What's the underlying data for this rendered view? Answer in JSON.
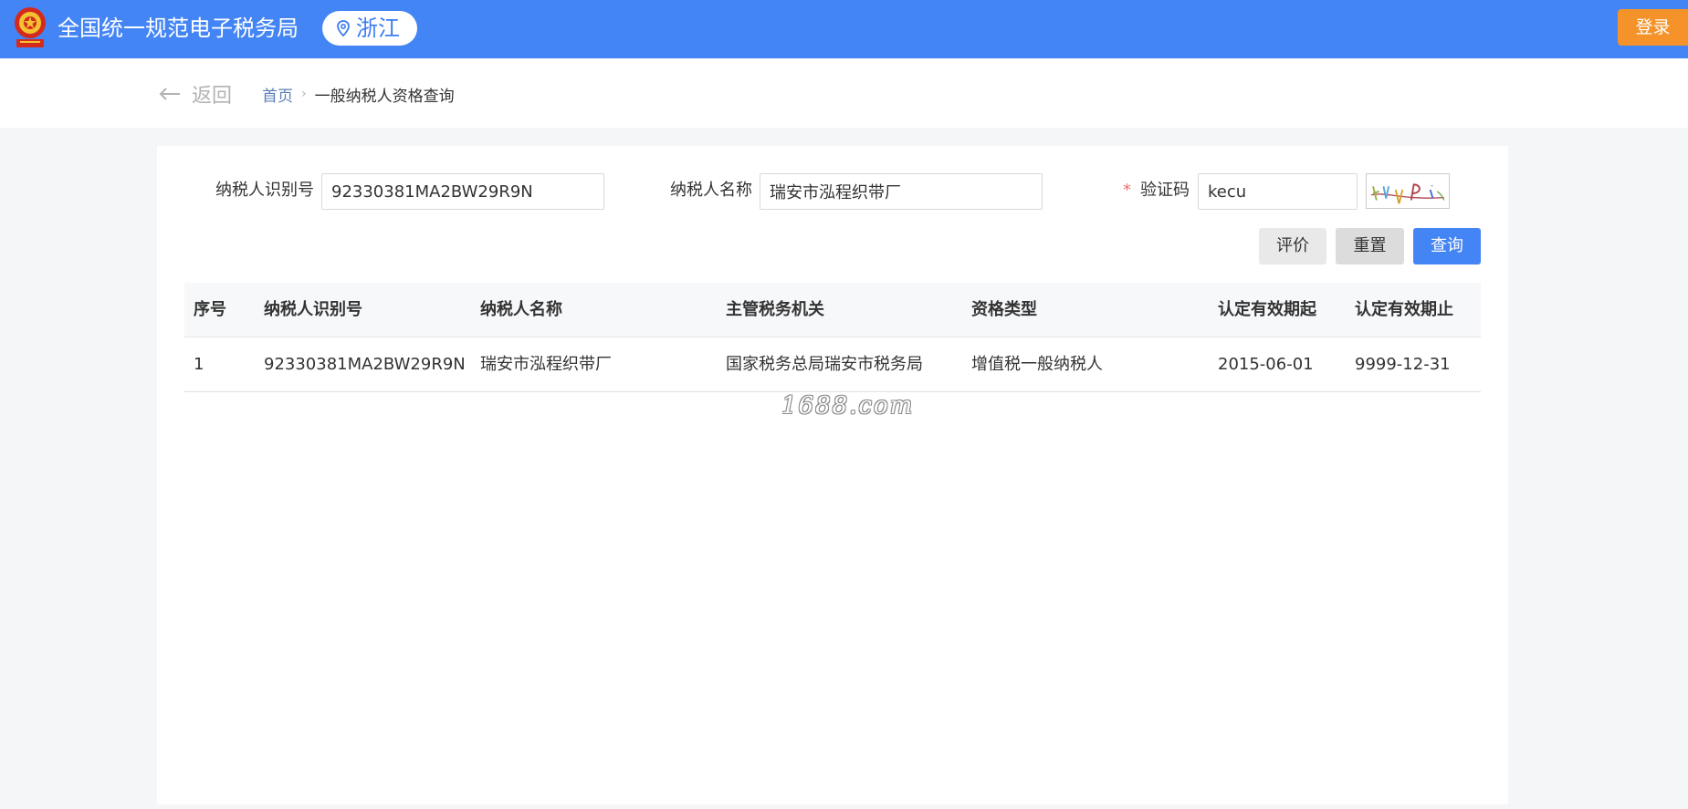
{
  "header": {
    "site_title": "全国统一规范电子税务局",
    "region": "浙江",
    "login_label": "登录",
    "emblem_icon": "national-tax-emblem-icon",
    "pin_icon": "location-pin-icon"
  },
  "breadcrumb": {
    "back_label": "返回",
    "home": "首页",
    "separator": "›",
    "current": "一般纳税人资格查询"
  },
  "form": {
    "taxpayer_id_label": "纳税人识别号",
    "taxpayer_id_value": "92330381MA2BW29R9N",
    "taxpayer_name_label": "纳税人名称",
    "taxpayer_name_value": "瑞安市泓程织带厂",
    "captcha_required_mark": "*",
    "captcha_label": "验证码",
    "captcha_value": "kecu"
  },
  "buttons": {
    "evaluate": "评价",
    "reset": "重置",
    "query": "查询"
  },
  "table": {
    "columns": [
      "序号",
      "纳税人识别号",
      "纳税人名称",
      "主管税务机关",
      "资格类型",
      "认定有效期起",
      "认定有效期止"
    ],
    "rows": [
      [
        "1",
        "92330381MA2BW29R9N",
        "瑞安市泓程织带厂",
        "国家税务总局瑞安市税务局",
        "增值税一般纳税人",
        "2015-06-01",
        "9999-12-31"
      ]
    ]
  },
  "watermark": "1688.com",
  "colors": {
    "header_bg": "#4485f5",
    "login_bg": "#f5922a",
    "query_btn_bg": "#4485f5",
    "required_star": "#f56c6c"
  }
}
